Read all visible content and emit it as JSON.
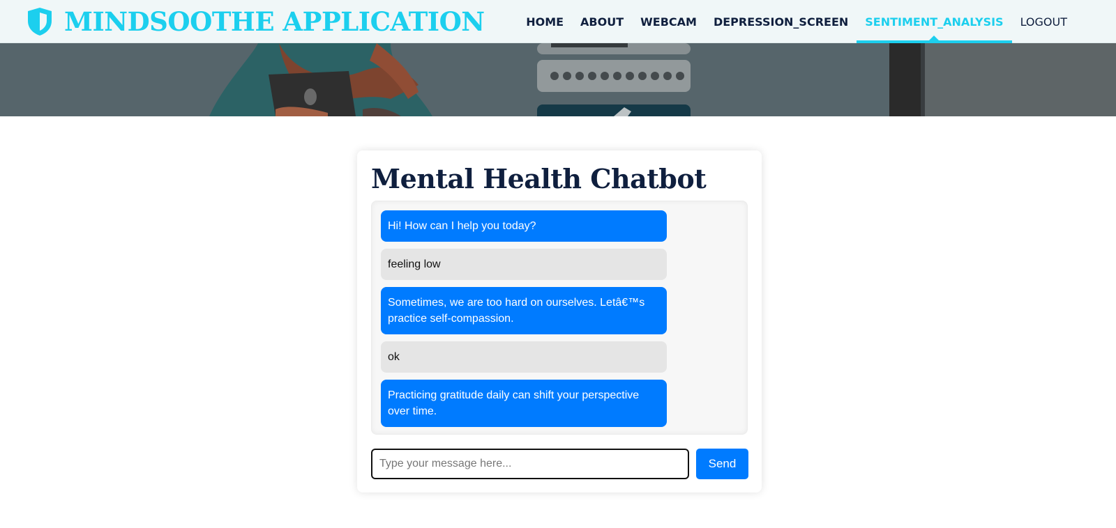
{
  "brand": {
    "title": "MINDSOOTHE APPLICATION",
    "icon": "shield-icon"
  },
  "nav": {
    "items": [
      {
        "label": "HOME"
      },
      {
        "label": "ABOUT"
      },
      {
        "label": "WEBCAM"
      },
      {
        "label": "DEPRESSION_SCREEN"
      },
      {
        "label": "SENTIMENT_ANALYSIS",
        "active": true
      },
      {
        "label": "LOGOUT"
      }
    ]
  },
  "colors": {
    "brand": "#1ccfee",
    "navy": "#0f1f3e",
    "bot_bubble": "#007bff",
    "user_bubble": "#e5e5e5"
  },
  "chatbot": {
    "title": "Mental Health Chatbot",
    "messages": [
      {
        "sender": "bot",
        "text": "Hi! How can I help you today?"
      },
      {
        "sender": "user",
        "text": "feeling low"
      },
      {
        "sender": "bot",
        "text": "Sometimes, we are too hard on ourselves. Letâ€™s practice self-compassion."
      },
      {
        "sender": "user",
        "text": "ok"
      },
      {
        "sender": "bot",
        "text": "Practicing gratitude daily can shift your perspective over time."
      }
    ],
    "input": {
      "placeholder": "Type your message here...",
      "value": ""
    },
    "send_label": "Send"
  }
}
